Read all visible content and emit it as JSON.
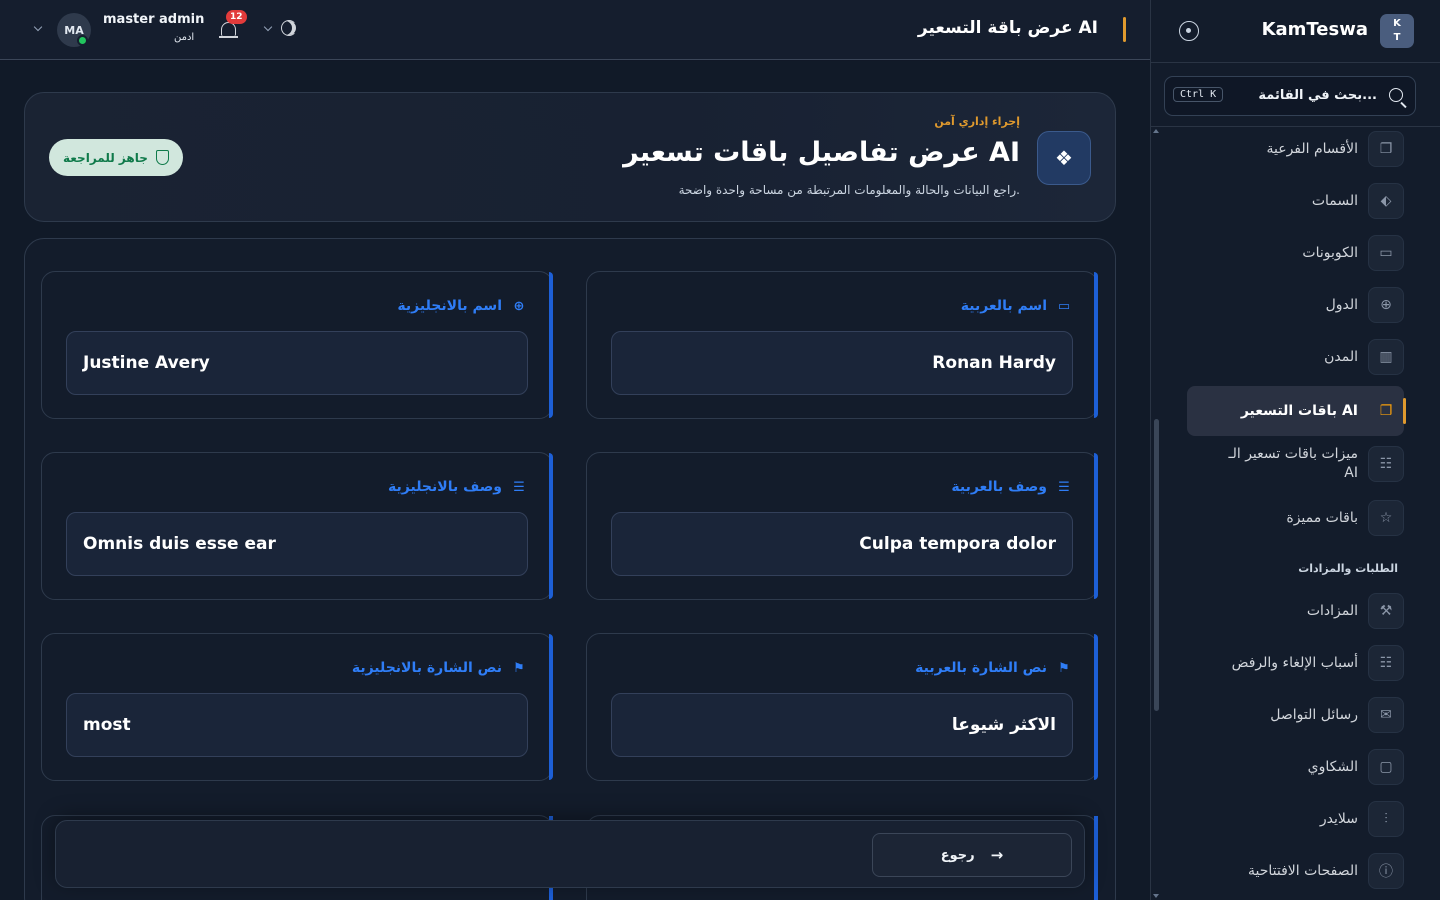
{
  "topbar": {
    "page_title": "عرض باقة التسعير AI",
    "notifications_count": "12",
    "user_name": "master admin",
    "user_role": "ادمن",
    "avatar_initials": "MA"
  },
  "sidebar": {
    "brand": "KamTeswa",
    "logo_line1": "K",
    "logo_line2": "T",
    "search_placeholder": "بحث في القائمة...",
    "search_shortcut": "Ctrl K",
    "items": [
      {
        "label": "الأقسام الفرعية",
        "icon": "copy-icon"
      },
      {
        "label": "السمات",
        "icon": "tag-icon"
      },
      {
        "label": "الكوبونات",
        "icon": "ticket-icon"
      },
      {
        "label": "الدول",
        "icon": "globe-icon"
      },
      {
        "label": "المدن",
        "icon": "building-icon"
      },
      {
        "label": "باقات التسعير AI",
        "icon": "copy-icon",
        "active": true
      },
      {
        "label_line1": "ميزات باقات تسعير الـ",
        "label_line2": "AI",
        "icon": "list-icon"
      },
      {
        "label": "باقات مميزة",
        "icon": "star-icon"
      }
    ],
    "section_orders": "الطلبات والمزادات",
    "items2": [
      {
        "label": "المزادات",
        "icon": "gavel-icon"
      },
      {
        "label": "أسباب الإلغاء والرفض",
        "icon": "list-icon"
      },
      {
        "label": "رسائل التواصل",
        "icon": "mail-icon"
      },
      {
        "label": "الشكاوي",
        "icon": "chat-icon"
      },
      {
        "label": "سلايدر",
        "icon": "sliders-icon"
      },
      {
        "label": "الصفحات الافتتاحية",
        "icon": "info-icon"
      }
    ]
  },
  "hero": {
    "kicker": "إجراء إداري آمن",
    "title": "عرض تفاصيل باقات تسعير AI",
    "subtitle": "راجع البيانات والحالة والمعلومات المرتبطة من مساحة واحدة واضحة.",
    "status": "جاهز للمراجعة"
  },
  "fields": {
    "name_ar_label": "اسم بالعربية",
    "name_ar_value": "Ronan Hardy",
    "name_en_label": "اسم بالانجليزية",
    "name_en_value": "Justine Avery",
    "desc_ar_label": "وصف بالعربية",
    "desc_ar_value": "Culpa tempora dolor",
    "desc_en_label": "وصف بالانجليزية",
    "desc_en_value": "Omnis duis esse ear",
    "badge_ar_label": "نص الشارة بالعربية",
    "badge_ar_value": "الاكثر شيوعا",
    "badge_en_label": "نص الشارة بالانجليزية",
    "badge_en_value": "most"
  },
  "footer": {
    "back_label": "رجوع"
  },
  "colors": {
    "accent": "#e09a2e",
    "primary": "#1d5fd6",
    "success": "#0f7a4a",
    "danger": "#e23b3b"
  }
}
